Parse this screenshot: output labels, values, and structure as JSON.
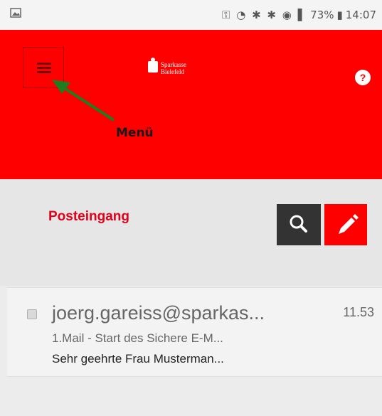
{
  "status_bar": {
    "battery": "73%",
    "time": "14:07"
  },
  "header": {
    "logo_line1": "Sparkasse",
    "logo_line2": "Bielefeld",
    "help_symbol": "?",
    "annotation": "Menü",
    "accent_color": "#fe0000"
  },
  "subheader": {
    "title": "Posteingang"
  },
  "mail": {
    "sender": "joerg.gareiss@sparkas...",
    "subject": "1.Mail - Start des Sichere E-M...",
    "preview": "Sehr geehrte Frau Musterman...",
    "time": "11.53"
  }
}
